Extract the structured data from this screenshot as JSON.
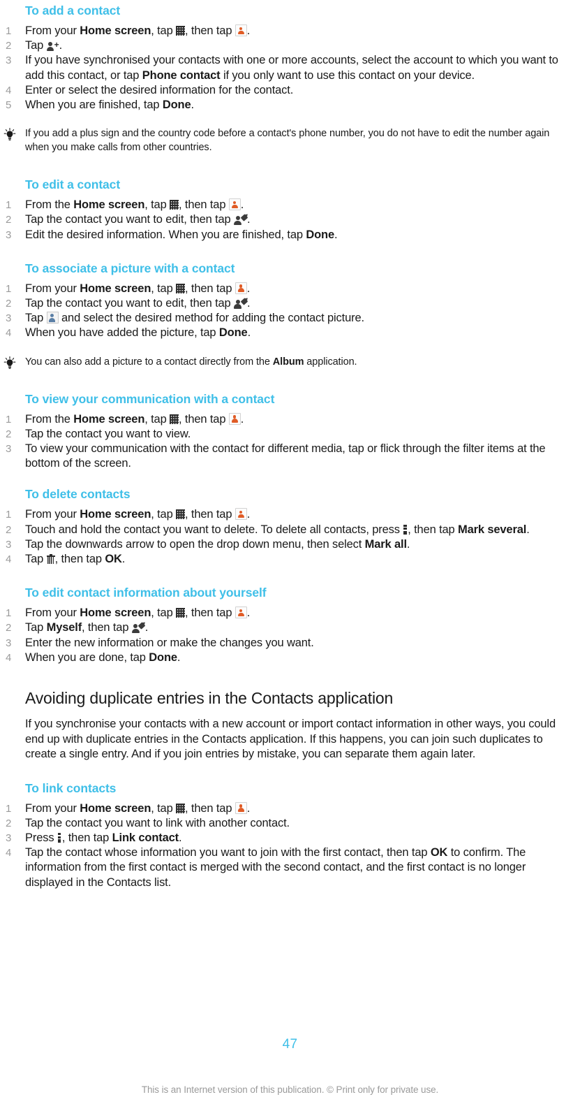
{
  "document": {
    "page_number": "47",
    "footer_note": "This is an Internet version of this publication. © Print only for private use.",
    "accent_color": "#3fbfe8",
    "text_color": "#1a1a1a",
    "muted_color": "#9a9a9a"
  },
  "sections": {
    "add_contact": {
      "heading": "To add a contact",
      "steps": {
        "s1_a": "From your ",
        "s1_b": "Home screen",
        "s1_c": ", tap ",
        "s1_d": ", then tap ",
        "s1_e": ".",
        "s2_a": "Tap ",
        "s2_b": ".",
        "s3_a": "If you have synchronised your contacts with one or more accounts, select the account to which you want to add this contact, or tap ",
        "s3_b": "Phone contact",
        "s3_c": " if you only want to use this contact on your device.",
        "s4": "Enter or select the desired information for the contact.",
        "s5_a": "When you are finished, tap ",
        "s5_b": "Done",
        "s5_c": "."
      },
      "tip": "If you add a plus sign and the country code before a contact's phone number, you do not have to edit the number again when you make calls from other countries."
    },
    "edit_contact": {
      "heading": "To edit a contact",
      "steps": {
        "s1_a": "From the ",
        "s1_b": "Home screen",
        "s1_c": ", tap ",
        "s1_d": ", then tap ",
        "s1_e": ".",
        "s2_a": "Tap the contact you want to edit, then tap ",
        "s2_b": ".",
        "s3_a": "Edit the desired information. When you are finished, tap ",
        "s3_b": "Done",
        "s3_c": "."
      }
    },
    "associate_picture": {
      "heading": "To associate a picture with a contact",
      "steps": {
        "s1_a": "From your ",
        "s1_b": "Home screen",
        "s1_c": ", tap ",
        "s1_d": ", then tap ",
        "s1_e": ".",
        "s2_a": "Tap the contact you want to edit, then tap ",
        "s2_b": ".",
        "s3_a": "Tap ",
        "s3_b": " and select the desired method for adding the contact picture.",
        "s4_a": "When you have added the picture, tap ",
        "s4_b": "Done",
        "s4_c": "."
      },
      "tip_a": "You can also add a picture to a contact directly from the ",
      "tip_b": "Album",
      "tip_c": " application."
    },
    "view_communication": {
      "heading": "To view your communication with a contact",
      "steps": {
        "s1_a": "From the ",
        "s1_b": "Home screen",
        "s1_c": ", tap ",
        "s1_d": ", then tap ",
        "s1_e": ".",
        "s2": "Tap the contact you want to view.",
        "s3": "To view your communication with the contact for different media, tap or flick through the filter items at the bottom of the screen."
      }
    },
    "delete_contacts": {
      "heading": "To delete contacts",
      "steps": {
        "s1_a": "From your ",
        "s1_b": "Home screen",
        "s1_c": ", tap ",
        "s1_d": ", then tap ",
        "s1_e": ".",
        "s2_a": "Touch and hold the contact you want to delete. To delete all contacts, press ",
        "s2_b": ", then tap ",
        "s2_c": "Mark several",
        "s2_d": ".",
        "s3_a": "Tap the downwards arrow to open the drop down menu, then select ",
        "s3_b": "Mark all",
        "s3_c": ".",
        "s4_a": "Tap ",
        "s4_b": ", then tap ",
        "s4_c": "OK",
        "s4_d": "."
      }
    },
    "edit_own_info": {
      "heading": "To edit contact information about yourself",
      "steps": {
        "s1_a": "From your ",
        "s1_b": "Home screen",
        "s1_c": ", tap ",
        "s1_d": ", then tap ",
        "s1_e": ".",
        "s2_a": "Tap ",
        "s2_b": "Myself",
        "s2_c": ", then tap ",
        "s2_d": ".",
        "s3": "Enter the new information or make the changes you want.",
        "s4_a": "When you are done, tap ",
        "s4_b": "Done",
        "s4_c": "."
      }
    },
    "avoiding_duplicates": {
      "heading": "Avoiding duplicate entries in the Contacts application",
      "paragraph": "If you synchronise your contacts with a new account or import contact information in other ways, you could end up with duplicate entries in the Contacts application. If this happens, you can join such duplicates to create a single entry. And if you join entries by mistake, you can separate them again later."
    },
    "link_contacts": {
      "heading": "To link contacts",
      "steps": {
        "s1_a": "From your ",
        "s1_b": "Home screen",
        "s1_c": ", tap ",
        "s1_d": ", then tap ",
        "s1_e": ".",
        "s2": "Tap the contact you want to link with another contact.",
        "s3_a": "Press ",
        "s3_b": ", then tap ",
        "s3_c": "Link contact",
        "s3_d": ".",
        "s4_a": "Tap the contact whose information you want to join with the first contact, then tap ",
        "s4_b": "OK",
        "s4_c": " to confirm. The information from the first contact is merged with the second contact, and the first contact is no longer displayed in the Contacts list."
      }
    }
  },
  "icons": {
    "app_drawer": "app-drawer-icon",
    "contacts_app": "contacts-app-icon",
    "add_person": "add-person-icon",
    "edit_person": "edit-person-icon",
    "contact_picture": "contact-picture-icon",
    "menu_key": "overflow-menu-icon",
    "trash": "trash-icon",
    "tip_bulb": "lightbulb-icon"
  }
}
